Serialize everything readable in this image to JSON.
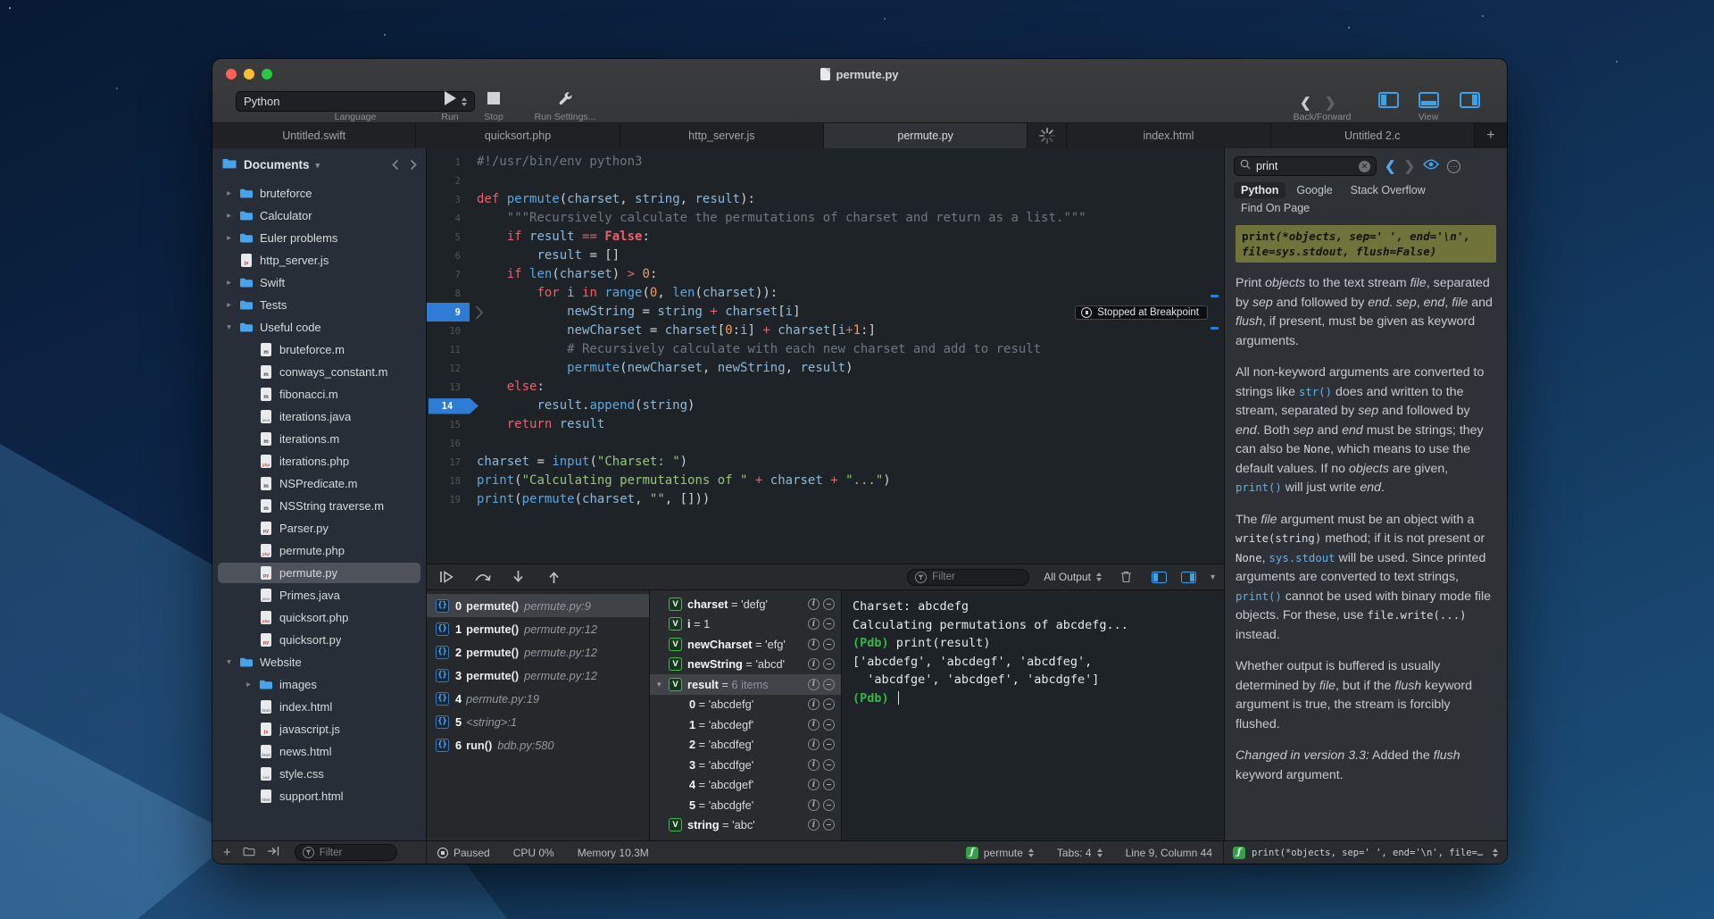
{
  "window": {
    "title": "permute.py"
  },
  "toolbar": {
    "language_value": "Python",
    "language_caption": "Language",
    "run_label": "Run",
    "stop_label": "Stop",
    "run_settings_label": "Run Settings...",
    "back_forward_caption": "Back/Forward",
    "view_caption": "View"
  },
  "tabs": {
    "items": [
      {
        "label": "Untitled.swift"
      },
      {
        "label": "quicksort.php"
      },
      {
        "label": "http_server.js"
      },
      {
        "label": "permute.py",
        "active": true
      },
      {
        "spinner": true
      },
      {
        "label": "index.html"
      },
      {
        "label": "Untitled 2.c"
      }
    ]
  },
  "sidebar": {
    "root_label": "Documents",
    "filter_placeholder": "Filter",
    "items": [
      {
        "name": "bruteforce",
        "icon": "folder",
        "chev": "r",
        "depth": 0
      },
      {
        "name": "Calculator",
        "icon": "folder",
        "chev": "r",
        "depth": 0
      },
      {
        "name": "Euler problems",
        "icon": "folder",
        "chev": "r",
        "depth": 0
      },
      {
        "name": "http_server.js",
        "icon": "js",
        "depth": 0
      },
      {
        "name": "Swift",
        "icon": "folder",
        "chev": "r",
        "depth": 0
      },
      {
        "name": "Tests",
        "icon": "folder",
        "chev": "r",
        "depth": 0
      },
      {
        "name": "Useful code",
        "icon": "folder",
        "chev": "d",
        "depth": 0
      },
      {
        "name": "bruteforce.m",
        "icon": "m",
        "depth": 1
      },
      {
        "name": "conways_constant.m",
        "icon": "m",
        "depth": 1
      },
      {
        "name": "fibonacci.m",
        "icon": "m",
        "depth": 1
      },
      {
        "name": "iterations.java",
        "icon": "java",
        "depth": 1
      },
      {
        "name": "iterations.m",
        "icon": "m",
        "depth": 1
      },
      {
        "name": "iterations.php",
        "icon": "php",
        "depth": 1
      },
      {
        "name": "NSPredicate.m",
        "icon": "m",
        "depth": 1
      },
      {
        "name": "NSString traverse.m",
        "icon": "m",
        "depth": 1
      },
      {
        "name": "Parser.py",
        "icon": "py",
        "depth": 1
      },
      {
        "name": "permute.php",
        "icon": "php",
        "depth": 1
      },
      {
        "name": "permute.py",
        "icon": "py",
        "depth": 1,
        "selected": true
      },
      {
        "name": "Primes.java",
        "icon": "java",
        "depth": 1
      },
      {
        "name": "quicksort.php",
        "icon": "php",
        "depth": 1
      },
      {
        "name": "quicksort.py",
        "icon": "py",
        "depth": 1
      },
      {
        "name": "Website",
        "icon": "folder",
        "chev": "d",
        "depth": 0
      },
      {
        "name": "images",
        "icon": "folder",
        "chev": "r",
        "depth": 1
      },
      {
        "name": "index.html",
        "icon": "html",
        "depth": 1
      },
      {
        "name": "javascript.js",
        "icon": "js",
        "depth": 1
      },
      {
        "name": "news.html",
        "icon": "html",
        "depth": 1
      },
      {
        "name": "style.css",
        "icon": "css",
        "depth": 1
      },
      {
        "name": "support.html",
        "icon": "html",
        "depth": 1
      }
    ]
  },
  "editor": {
    "current_line": 9,
    "breakpoint_line": 14,
    "stopped_badge": "Stopped at Breakpoint",
    "lines": [
      {
        "n": 1,
        "s": [
          [
            "c",
            "#!/usr/bin/env python3"
          ]
        ]
      },
      {
        "n": 2,
        "s": []
      },
      {
        "n": 3,
        "s": [
          [
            "k",
            "def "
          ],
          [
            "f",
            "permute"
          ],
          [
            "p",
            "("
          ],
          [
            "v",
            "charset"
          ],
          [
            "p",
            ", "
          ],
          [
            "v",
            "string"
          ],
          [
            "p",
            ", "
          ],
          [
            "v",
            "result"
          ],
          [
            "p",
            "):"
          ]
        ]
      },
      {
        "n": 4,
        "s": [
          [
            "c",
            "    \"\"\"Recursively calculate the permutations of charset and return as a list.\"\"\""
          ]
        ]
      },
      {
        "n": 5,
        "s": [
          [
            "p",
            "    "
          ],
          [
            "k",
            "if "
          ],
          [
            "v",
            "result"
          ],
          [
            "p",
            " "
          ],
          [
            "o",
            "=="
          ],
          [
            "p",
            " "
          ],
          [
            "kb",
            "False"
          ],
          [
            "p",
            ":"
          ]
        ]
      },
      {
        "n": 6,
        "s": [
          [
            "p",
            "        "
          ],
          [
            "v",
            "result"
          ],
          [
            "p",
            " = []"
          ]
        ]
      },
      {
        "n": 7,
        "s": [
          [
            "p",
            "    "
          ],
          [
            "k",
            "if "
          ],
          [
            "f",
            "len"
          ],
          [
            "p",
            "("
          ],
          [
            "v",
            "charset"
          ],
          [
            "p",
            ") "
          ],
          [
            "o",
            ">"
          ],
          [
            "p",
            " "
          ],
          [
            "num",
            "0"
          ],
          [
            "p",
            ":"
          ]
        ]
      },
      {
        "n": 8,
        "s": [
          [
            "p",
            "        "
          ],
          [
            "k",
            "for "
          ],
          [
            "v",
            "i"
          ],
          [
            "k",
            " in "
          ],
          [
            "f",
            "range"
          ],
          [
            "p",
            "("
          ],
          [
            "num",
            "0"
          ],
          [
            "p",
            ", "
          ],
          [
            "f",
            "len"
          ],
          [
            "p",
            "("
          ],
          [
            "v",
            "charset"
          ],
          [
            "p",
            ")):"
          ]
        ]
      },
      {
        "n": 9,
        "s": [
          [
            "p",
            "            "
          ],
          [
            "v",
            "newString"
          ],
          [
            "p",
            " = "
          ],
          [
            "v",
            "string"
          ],
          [
            "p",
            " "
          ],
          [
            "o",
            "+"
          ],
          [
            "p",
            " "
          ],
          [
            "v",
            "charset"
          ],
          [
            "p",
            "["
          ],
          [
            "v",
            "i"
          ],
          [
            "p",
            "]"
          ]
        ]
      },
      {
        "n": 10,
        "s": [
          [
            "p",
            "            "
          ],
          [
            "v",
            "newCharset"
          ],
          [
            "p",
            " = "
          ],
          [
            "v",
            "charset"
          ],
          [
            "p",
            "["
          ],
          [
            "num",
            "0"
          ],
          [
            "p",
            ":"
          ],
          [
            "v",
            "i"
          ],
          [
            "p",
            "] "
          ],
          [
            "o",
            "+"
          ],
          [
            "p",
            " "
          ],
          [
            "v",
            "charset"
          ],
          [
            "p",
            "["
          ],
          [
            "v",
            "i"
          ],
          [
            "o",
            "+"
          ],
          [
            "num",
            "1"
          ],
          [
            "p",
            ":]"
          ]
        ]
      },
      {
        "n": 11,
        "s": [
          [
            "c",
            "            # Recursively calculate with each new charset and add to result"
          ]
        ]
      },
      {
        "n": 12,
        "s": [
          [
            "p",
            "            "
          ],
          [
            "f",
            "permute"
          ],
          [
            "p",
            "("
          ],
          [
            "v",
            "newCharset"
          ],
          [
            "p",
            ", "
          ],
          [
            "v",
            "newString"
          ],
          [
            "p",
            ", "
          ],
          [
            "v",
            "result"
          ],
          [
            "p",
            ")"
          ]
        ]
      },
      {
        "n": 13,
        "s": [
          [
            "p",
            "    "
          ],
          [
            "k",
            "else"
          ],
          [
            "p",
            ":"
          ]
        ]
      },
      {
        "n": 14,
        "s": [
          [
            "p",
            "        "
          ],
          [
            "v",
            "result"
          ],
          [
            "p",
            "."
          ],
          [
            "f",
            "append"
          ],
          [
            "p",
            "("
          ],
          [
            "v",
            "string"
          ],
          [
            "p",
            ")"
          ]
        ]
      },
      {
        "n": 15,
        "s": [
          [
            "p",
            "    "
          ],
          [
            "k",
            "return "
          ],
          [
            "v",
            "result"
          ]
        ]
      },
      {
        "n": 16,
        "s": []
      },
      {
        "n": 17,
        "s": [
          [
            "v",
            "charset"
          ],
          [
            "p",
            " = "
          ],
          [
            "f",
            "input"
          ],
          [
            "p",
            "("
          ],
          [
            "s",
            "\"Charset: \""
          ],
          [
            "p",
            ")"
          ]
        ]
      },
      {
        "n": 18,
        "s": [
          [
            "f",
            "print"
          ],
          [
            "p",
            "("
          ],
          [
            "s",
            "\"Calculating permutations of \""
          ],
          [
            "p",
            " "
          ],
          [
            "o",
            "+"
          ],
          [
            "p",
            " "
          ],
          [
            "v",
            "charset"
          ],
          [
            "p",
            " "
          ],
          [
            "o",
            "+"
          ],
          [
            "p",
            " "
          ],
          [
            "s",
            "\"...\""
          ],
          [
            "p",
            ")"
          ]
        ]
      },
      {
        "n": 19,
        "s": [
          [
            "f",
            "print"
          ],
          [
            "p",
            "("
          ],
          [
            "f",
            "permute"
          ],
          [
            "p",
            "("
          ],
          [
            "v",
            "charset"
          ],
          [
            "p",
            ", "
          ],
          [
            "s",
            "\"\""
          ],
          [
            "p",
            ", []))"
          ]
        ]
      }
    ]
  },
  "debugger": {
    "filter_placeholder": "Filter",
    "output_select": "All Output",
    "stack": [
      {
        "i": "0",
        "fn": "permute()",
        "loc": "permute.py:9",
        "sel": true
      },
      {
        "i": "1",
        "fn": "permute()",
        "loc": "permute.py:12"
      },
      {
        "i": "2",
        "fn": "permute()",
        "loc": "permute.py:12"
      },
      {
        "i": "3",
        "fn": "permute()",
        "loc": "permute.py:12"
      },
      {
        "i": "4",
        "fn": "",
        "loc": "permute.py:19"
      },
      {
        "i": "5",
        "fn": "",
        "loc": "<string>:1"
      },
      {
        "i": "6",
        "fn": "run()",
        "loc": "bdb.py:580"
      }
    ],
    "variables": [
      {
        "v": true,
        "name": "charset",
        "val": "'defg'"
      },
      {
        "v": true,
        "name": "i",
        "val": "1"
      },
      {
        "v": true,
        "name": "newCharset",
        "val": "'efg'"
      },
      {
        "v": true,
        "name": "newString",
        "val": "'abcd'"
      },
      {
        "v": true,
        "name": "result",
        "val": "",
        "dim": "6 items",
        "exp": true,
        "sel": true
      },
      {
        "name": "0",
        "val": "'abcdefg'",
        "child": true
      },
      {
        "name": "1",
        "val": "'abcdegf'",
        "child": true
      },
      {
        "name": "2",
        "val": "'abcdfeg'",
        "child": true
      },
      {
        "name": "3",
        "val": "'abcdfge'",
        "child": true
      },
      {
        "name": "4",
        "val": "'abcdgef'",
        "child": true
      },
      {
        "name": "5",
        "val": "'abcdgfe'",
        "child": true
      },
      {
        "v": true,
        "name": "string",
        "val": "'abc'"
      }
    ],
    "console": [
      [
        [
          "plain",
          "Charset: abcdefg"
        ]
      ],
      [
        [
          "plain",
          "Calculating permutations of abcdefg..."
        ]
      ],
      [
        [
          "pdb",
          "(Pdb) "
        ],
        [
          "plain",
          "print(result)"
        ]
      ],
      [
        [
          "plain",
          "['abcdefg', 'abcdegf', 'abcdfeg',"
        ]
      ],
      [
        [
          "plain",
          "  'abcdfge', 'abcdgef', 'abcdgfe']"
        ]
      ],
      [
        [
          "pdb",
          "(Pdb) "
        ],
        [
          "cursor",
          ""
        ]
      ]
    ]
  },
  "docs": {
    "search_value": "print",
    "tabs": [
      "Python",
      "Google",
      "Stack Overflow",
      "Find On Page"
    ],
    "active_tab": "Python",
    "signature": {
      "name": "print",
      "rest": "(*objects, sep=' ', end='\\n',",
      "line2": "file=sys.stdout, flush=False)"
    },
    "paragraphs": [
      [
        [
          "p",
          "Print "
        ],
        [
          "em",
          "objects"
        ],
        [
          "p",
          " to the text stream "
        ],
        [
          "em",
          "file"
        ],
        [
          "p",
          ", separated by "
        ],
        [
          "em",
          "sep"
        ],
        [
          "p",
          " and followed by "
        ],
        [
          "em",
          "end"
        ],
        [
          "p",
          ". "
        ],
        [
          "em",
          "sep"
        ],
        [
          "p",
          ", "
        ],
        [
          "em",
          "end"
        ],
        [
          "p",
          ", "
        ],
        [
          "em",
          "file"
        ],
        [
          "p",
          " and "
        ],
        [
          "em",
          "flush"
        ],
        [
          "p",
          ", if present, must be given as keyword arguments."
        ]
      ],
      [
        [
          "p",
          "All non-keyword arguments are converted to strings like "
        ],
        [
          "link",
          "str()"
        ],
        [
          "p",
          " does and written to the stream, separated by "
        ],
        [
          "em",
          "sep"
        ],
        [
          "p",
          " and followed by "
        ],
        [
          "em",
          "end"
        ],
        [
          "p",
          ". Both "
        ],
        [
          "em",
          "sep"
        ],
        [
          "p",
          " and "
        ],
        [
          "em",
          "end"
        ],
        [
          "p",
          " must be strings; they can also be "
        ],
        [
          "code",
          "None"
        ],
        [
          "p",
          ", which means to use the default values. If no "
        ],
        [
          "em",
          "objects"
        ],
        [
          "p",
          " are given, "
        ],
        [
          "link",
          "print()"
        ],
        [
          "p",
          " will just write "
        ],
        [
          "em",
          "end"
        ],
        [
          "p",
          "."
        ]
      ],
      [
        [
          "p",
          "The "
        ],
        [
          "em",
          "file"
        ],
        [
          "p",
          " argument must be an object with a "
        ],
        [
          "code",
          "write(string)"
        ],
        [
          "p",
          " method; if it is not present or "
        ],
        [
          "code",
          "None"
        ],
        [
          "p",
          ", "
        ],
        [
          "link",
          "sys.stdout"
        ],
        [
          "p",
          " will be used. Since printed arguments are converted to text strings, "
        ],
        [
          "link",
          "print()"
        ],
        [
          "p",
          " cannot be used with binary mode file objects. For these, use "
        ],
        [
          "code",
          "file.write(...)"
        ],
        [
          "p",
          " instead."
        ]
      ],
      [
        [
          "p",
          "Whether output is buffered is usually determined by "
        ],
        [
          "em",
          "file"
        ],
        [
          "p",
          ", but if the "
        ],
        [
          "em",
          "flush"
        ],
        [
          "p",
          " keyword argument is true, the stream is forcibly flushed."
        ]
      ],
      [
        [
          "em",
          "Changed in version 3.3:"
        ],
        [
          "p",
          " Added the "
        ],
        [
          "em",
          "flush"
        ],
        [
          "p",
          " keyword argument."
        ]
      ]
    ],
    "footer_signature": "print(*objects, sep=' ', end='\\n', file=sys.st…"
  },
  "statusbar": {
    "paused_label": "Paused",
    "cpu_label": "CPU 0%",
    "memory_label": "Memory 10.3M",
    "function_name": "permute",
    "tabs_count": "Tabs: 4",
    "cursor_position": "Line 9, Column 44"
  }
}
